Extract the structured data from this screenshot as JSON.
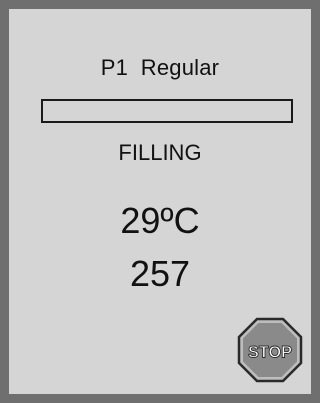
{
  "program": {
    "label": "P1  Regular"
  },
  "progress": {
    "fraction": 0
  },
  "status": {
    "text": "FILLING"
  },
  "readings": {
    "temperature": "29ºC",
    "counter": "257"
  },
  "stop_button": {
    "label": "STOP"
  },
  "colors": {
    "frame": "#6f6f6f",
    "screen": "#d5d5d5",
    "stop_fill": "#bdbdbd",
    "stop_outline": "#2a2a2a"
  }
}
